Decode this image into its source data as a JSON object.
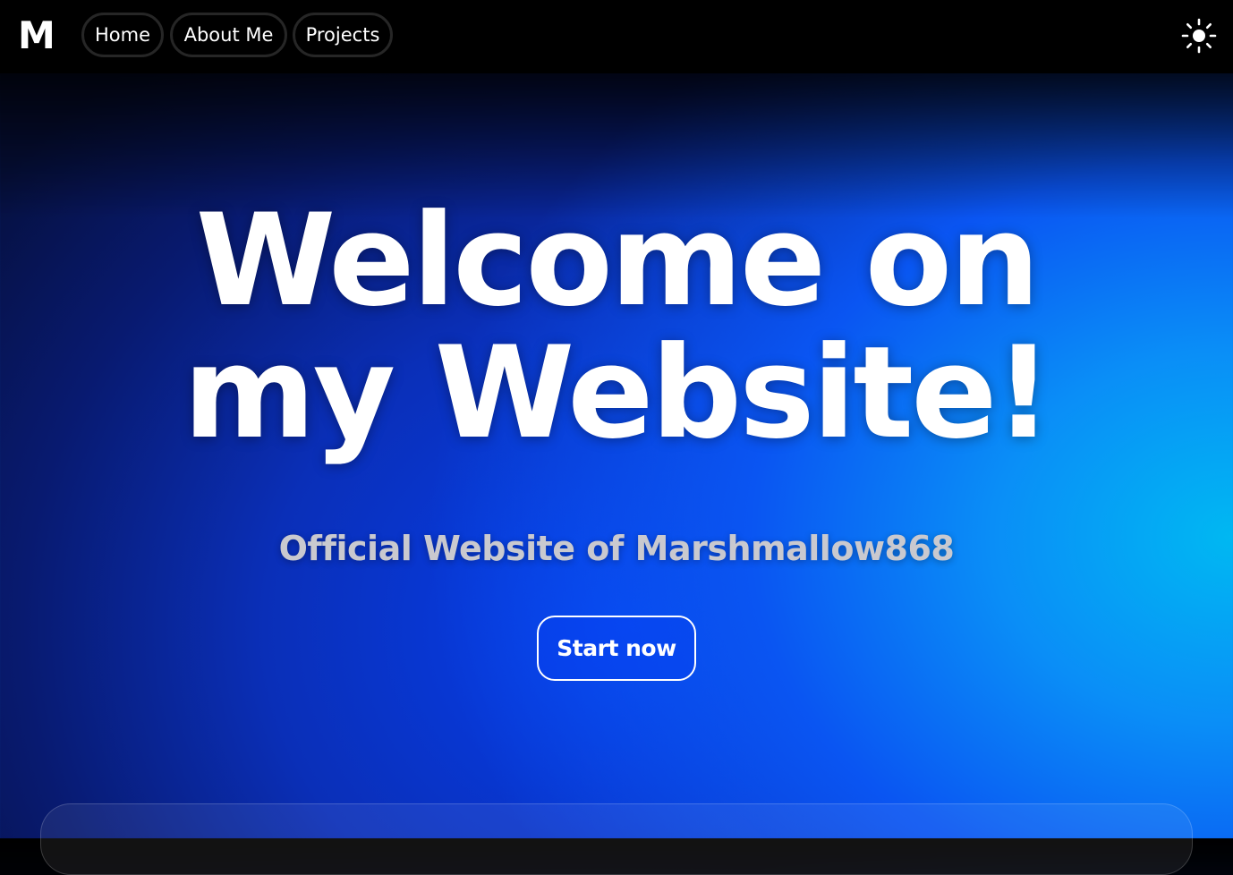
{
  "nav": {
    "logo": "M",
    "items": [
      {
        "label": "Home"
      },
      {
        "label": "About Me"
      },
      {
        "label": "Projects"
      }
    ],
    "theme_toggle_icon": "sun-icon"
  },
  "hero": {
    "title_line1": "Welcome on",
    "title_line2": "my Website!",
    "subtitle": "Official Website of Marshmallow868",
    "cta_label": "Start now"
  },
  "colors": {
    "nav_background": "#000000",
    "gradient_dark": "#06103f",
    "gradient_mid": "#0640f0",
    "gradient_light": "#00b8f2",
    "subtitle_text": "#c9c9cf"
  }
}
